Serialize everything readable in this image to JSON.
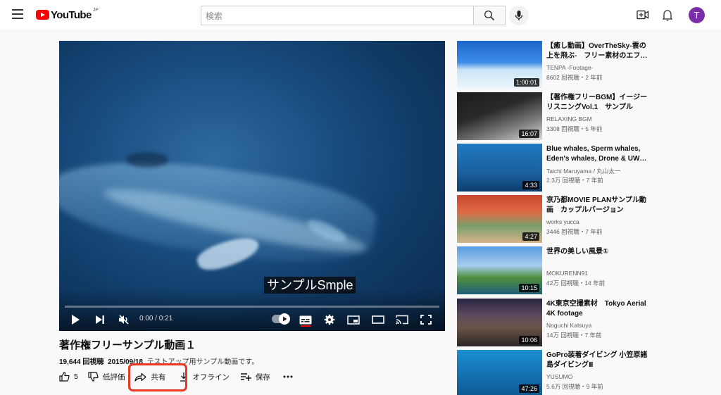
{
  "header": {
    "logo_text": "YouTube",
    "logo_region": "JP",
    "search_placeholder": "検索"
  },
  "player": {
    "subtitle": "サンプルSmple",
    "time": "0:00 / 0:21",
    "progress": 0.0
  },
  "video": {
    "title": "著作権フリーサンプル動画１",
    "views": "19,644 回視聴",
    "date": "2015/09/18",
    "description": "テストアップ用サンプル動画です。"
  },
  "actions": {
    "like_count": "5",
    "dislike_label": "低評価",
    "share_label": "共有",
    "offline_label": "オフライン",
    "save_label": "保存"
  },
  "user": {
    "avatar_letter": "T",
    "avatar_color": "#7b2ea8"
  },
  "recommendations": [
    {
      "title": "【癒し動画】OverTheSky-雲の上を飛ぶ-　フリー素材のエフ…",
      "channel": "TENPA -Footage-",
      "stats": "8602 回視聴・2 年前",
      "duration": "1:00:01"
    },
    {
      "title": "【著作権フリーBGM】イージーリスニングVol.1　サンプル",
      "channel": "RELAXING BGM",
      "stats": "3308 回視聴・5 年前",
      "duration": "16:07"
    },
    {
      "title": "Blue whales, Sperm whales, Eden's whales, Drone & UW…",
      "channel": "Taichi Maruyama / 丸山太一",
      "stats": "2.3万 回視聴・7 年前",
      "duration": "4:33"
    },
    {
      "title": "京乃都MOVIE PLANサンプル動画　カップルバージョン",
      "channel": "works yucca",
      "stats": "3446 回視聴・7 年前",
      "duration": "4:27"
    },
    {
      "title": "世界の美しい風景①",
      "channel": "MOKURENN91",
      "stats": "42万 回視聴・14 年前",
      "duration": "10:15"
    },
    {
      "title": "4K東京空撮素材　Tokyo Aerial 4K footage",
      "channel": "Noguchi Katsuya",
      "stats": "14万 回視聴・7 年前",
      "duration": "10:06"
    },
    {
      "title": "GoPro装着ダイビング 小笠原諸島ダイビングⅡ",
      "channel": "YUSUMO",
      "stats": "5.6万 回視聴・9 年前",
      "duration": "47:26"
    }
  ],
  "highlight_color": "#e8381f"
}
